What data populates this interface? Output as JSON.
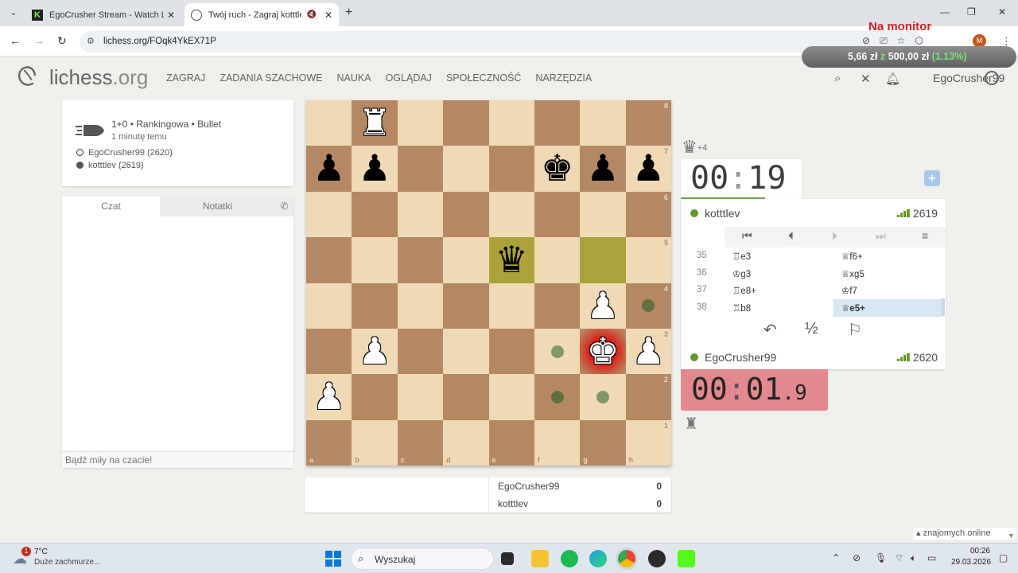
{
  "browser": {
    "tabs": [
      {
        "title": "EgoCrusher Stream - Watch Live",
        "favicon": "kick-icon",
        "active": false
      },
      {
        "title": "Twój ruch - Zagraj kotttlev",
        "favicon": "lichess-icon",
        "active": true
      }
    ],
    "url": "lichess.org/FOqk4YkEX71P"
  },
  "overlay": {
    "title": "Na monitor",
    "amount": "5,66 zł",
    "sep": " z ",
    "goal": "500,00 zł",
    "pct": "(1.13%)"
  },
  "site": {
    "logo": "lichess",
    "logo_tld": ".org",
    "nav": [
      "ZAGRAJ",
      "ZADANIA SZACHOWE",
      "NAUKA",
      "OGLĄDAJ",
      "SPOŁECZNOŚĆ",
      "NARZĘDZIA"
    ],
    "username": "EgoCrusher99"
  },
  "game_info": {
    "line1": "1+0 • Rankingowa • Bullet",
    "line2": "1 minutę temu",
    "white": "EgoCrusher99 (2620)",
    "black": "kotttlev (2619)"
  },
  "chat": {
    "tab_chat": "Czat",
    "tab_notes": "Notatki",
    "placeholder": "Bądź miły na czacie!"
  },
  "board": {
    "pieces": [
      {
        "sq": "b8",
        "p": "♜",
        "c": "white"
      },
      {
        "sq": "a7",
        "p": "♟",
        "c": "black"
      },
      {
        "sq": "b7",
        "p": "♟",
        "c": "black"
      },
      {
        "sq": "f7",
        "p": "♚",
        "c": "black"
      },
      {
        "sq": "g7",
        "p": "♟",
        "c": "black"
      },
      {
        "sq": "h7",
        "p": "♟",
        "c": "black"
      },
      {
        "sq": "e5",
        "p": "♛",
        "c": "black"
      },
      {
        "sq": "g4",
        "p": "♟",
        "c": "white"
      },
      {
        "sq": "b3",
        "p": "♟",
        "c": "white"
      },
      {
        "sq": "g3",
        "p": "♚",
        "c": "white"
      },
      {
        "sq": "h3",
        "p": "♟",
        "c": "white"
      },
      {
        "sq": "a2",
        "p": "♟",
        "c": "white"
      }
    ],
    "last_move": [
      "g5",
      "e5"
    ],
    "check": "g3",
    "move_dots": [
      "h4",
      "f3",
      "f2",
      "g2"
    ],
    "files": [
      "a",
      "b",
      "c",
      "d",
      "e",
      "f",
      "g",
      "h"
    ],
    "ranks": [
      "8",
      "7",
      "6",
      "5",
      "4",
      "3",
      "2",
      "1"
    ]
  },
  "score": {
    "p1": "EgoCrusher99",
    "s1": "0",
    "p2": "kotttlev",
    "s2": "0"
  },
  "right": {
    "material_top": "+4",
    "clock_top": {
      "mm": "00",
      "ss": "19"
    },
    "opponent": {
      "name": "kotttlev",
      "rating": "2619"
    },
    "me": {
      "name": "EgoCrusher99",
      "rating": "2620"
    },
    "clock_bot": {
      "mm": "00",
      "ss": "01",
      "tenths": "9"
    },
    "moves": [
      {
        "n": "35",
        "w": "♖e3",
        "b": "♕f6+"
      },
      {
        "n": "36",
        "w": "♔g3",
        "b": "♕xg5"
      },
      {
        "n": "37",
        "w": "♖e8+",
        "b": "♔f7"
      },
      {
        "n": "38",
        "w": "♖b8",
        "b": "♕e5+"
      }
    ],
    "actions": {
      "takeback": "↶",
      "draw": "½",
      "resign": "⚐"
    }
  },
  "friends": "znajomych online",
  "taskbar": {
    "weather_temp": "7°C",
    "weather_desc": "Duże zachmurze...",
    "weather_badge": "1",
    "search": "Wyszukaj",
    "time": "00:26",
    "date": "29.03.2026"
  }
}
